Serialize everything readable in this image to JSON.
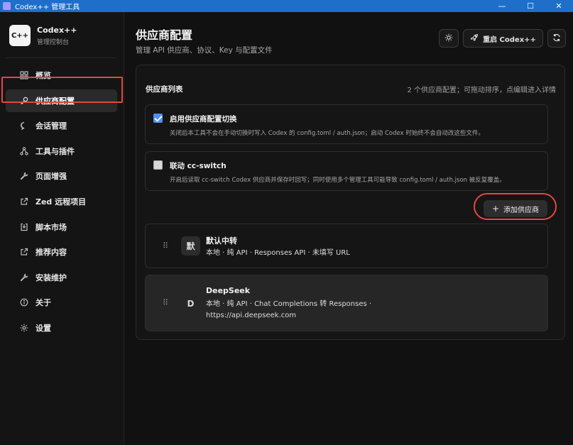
{
  "window": {
    "title": "Codex++ 管理工具",
    "minimize": "—",
    "maximize": "☐",
    "close": "✕"
  },
  "brand": {
    "logo_text": "C++",
    "name": "Codex++",
    "subtitle": "管理控制台"
  },
  "sidebar": {
    "items": [
      {
        "label": "概览",
        "icon": "grid-icon"
      },
      {
        "label": "供应商配置",
        "icon": "key-icon",
        "active": true
      },
      {
        "label": "会话管理",
        "icon": "chat-icon"
      },
      {
        "label": "工具与插件",
        "icon": "nodes-icon"
      },
      {
        "label": "页面增强",
        "icon": "wrench-icon"
      },
      {
        "label": "Zed 远程项目",
        "icon": "external-link-icon"
      },
      {
        "label": "脚本市场",
        "icon": "import-icon"
      },
      {
        "label": "推荐内容",
        "icon": "external-link-icon"
      },
      {
        "label": "安装维护",
        "icon": "wrench-icon"
      },
      {
        "label": "关于",
        "icon": "info-icon"
      },
      {
        "label": "设置",
        "icon": "gear-icon"
      }
    ]
  },
  "header": {
    "title": "供应商配置",
    "subtitle": "管理 API 供应商、协议、Key 与配置文件",
    "restart_label": "重启 Codex++"
  },
  "panel": {
    "title": "供应商列表",
    "hint": "2 个供应商配置；可拖动排序，点编辑进入详情",
    "options": [
      {
        "checked": true,
        "title": "启用供应商配置切换",
        "desc": "关闭后本工具不会在手动切换时写入 Codex 的 config.toml / auth.json；启动 Codex 时始终不会自动改这些文件。"
      },
      {
        "checked": false,
        "title": "联动 cc-switch",
        "desc": "开启后读取 cc-switch Codex 供应商并保存时回写；同时使用多个管理工具可能导致 config.toml / auth.json 被反复覆盖。"
      }
    ],
    "add_label": "添加供应商",
    "providers": [
      {
        "avatar": "默",
        "name": "默认中转",
        "meta_line1": "本地 · 纯 API · Responses API · 未填写 URL",
        "meta_line2": ""
      },
      {
        "avatar": "D",
        "name": "DeepSeek",
        "meta_line1": "本地 · 纯 API · Chat Completions 转 Responses ·",
        "meta_line2": "https://api.deepseek.com"
      }
    ]
  },
  "colors": {
    "titlebar": "#1e6fc9",
    "accent": "#4f8ff5",
    "highlight": "#e5473d"
  }
}
